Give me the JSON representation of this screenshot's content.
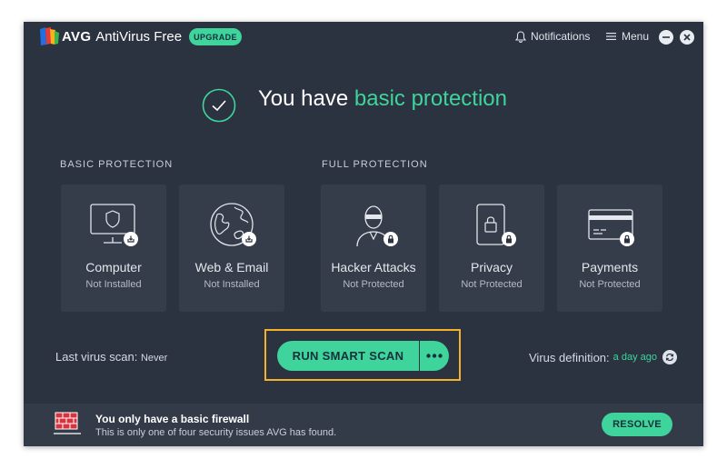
{
  "app": {
    "brand": "AVG",
    "name": "AntiVirus Free",
    "upgrade_label": "UPGRADE",
    "notifications_label": "Notifications",
    "menu_label": "Menu"
  },
  "hero": {
    "prefix": "You have ",
    "highlight": "basic protection"
  },
  "sections": {
    "basic": "BASIC PROTECTION",
    "full": "FULL PROTECTION"
  },
  "cards": [
    {
      "title": "Computer",
      "status": "Not Installed",
      "icon": "monitor-shield-icon",
      "badge": "install-badge-icon"
    },
    {
      "title": "Web & Email",
      "status": "Not Installed",
      "icon": "globe-icon",
      "badge": "install-badge-icon"
    },
    {
      "title": "Hacker Attacks",
      "status": "Not Protected",
      "icon": "hacker-icon",
      "badge": "lock-badge-icon"
    },
    {
      "title": "Privacy",
      "status": "Not Protected",
      "icon": "privacy-lock-icon",
      "badge": "lock-badge-icon"
    },
    {
      "title": "Payments",
      "status": "Not Protected",
      "icon": "credit-card-icon",
      "badge": "lock-badge-icon"
    }
  ],
  "scan": {
    "last_scan_label": "Last virus scan:",
    "last_scan_value": "Never",
    "button_label": "RUN SMART SCAN",
    "virus_def_label": "Virus definition:",
    "virus_def_value": "a day ago"
  },
  "footer": {
    "title": "You only have a basic firewall",
    "subtitle": "This is only one of four security issues AVG has found.",
    "resolve_label": "RESOLVE"
  },
  "colors": {
    "background": "#2b3240",
    "card": "#353c4a",
    "accent": "#3ed49b",
    "firewall": "#d8343f",
    "highlight_border": "#f3b12d"
  }
}
